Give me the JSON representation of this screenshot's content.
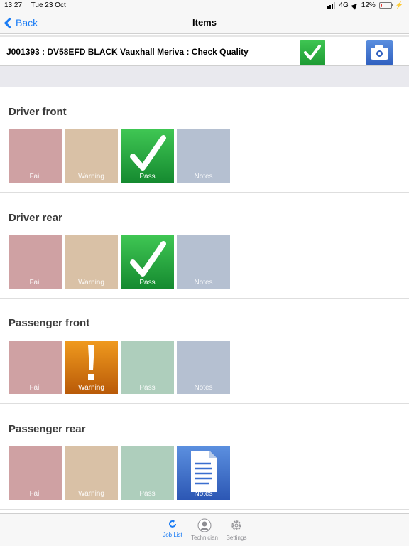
{
  "status_bar": {
    "time": "13:27",
    "date": "Tue 23 Oct",
    "network": "4G",
    "battery_percent": "12%",
    "battery_level": 0.12
  },
  "nav": {
    "back_label": "Back",
    "title": "Items"
  },
  "job": {
    "title": "J001393 : DV58EFD BLACK Vauxhall Meriva : Check Quality"
  },
  "colors": {
    "accent": "#1a7cf5",
    "pass": "#2db047",
    "warning": "#e58a16",
    "notes": "#3b6fcf",
    "fail": "#cfa1a3"
  },
  "sections": [
    {
      "title": "Driver front",
      "selected": "pass",
      "buttons": {
        "fail": "Fail",
        "warning": "Warning",
        "pass": "Pass",
        "notes": "Notes"
      }
    },
    {
      "title": "Driver rear",
      "selected": "pass",
      "buttons": {
        "fail": "Fail",
        "warning": "Warning",
        "pass": "Pass",
        "notes": "Notes"
      }
    },
    {
      "title": "Passenger front",
      "selected": "warning",
      "buttons": {
        "fail": "Fail",
        "warning": "Warning",
        "pass": "Pass",
        "notes": "Notes"
      }
    },
    {
      "title": "Passenger rear",
      "selected": "notes",
      "buttons": {
        "fail": "Fail",
        "warning": "Warning",
        "pass": "Pass",
        "notes": "Notes"
      }
    }
  ],
  "tab_bar": {
    "items": [
      {
        "label": "Job List",
        "icon": "refresh-icon",
        "active": true
      },
      {
        "label": "Technician",
        "icon": "person-icon",
        "active": false
      },
      {
        "label": "Settings",
        "icon": "gear-icon",
        "active": false
      }
    ]
  }
}
